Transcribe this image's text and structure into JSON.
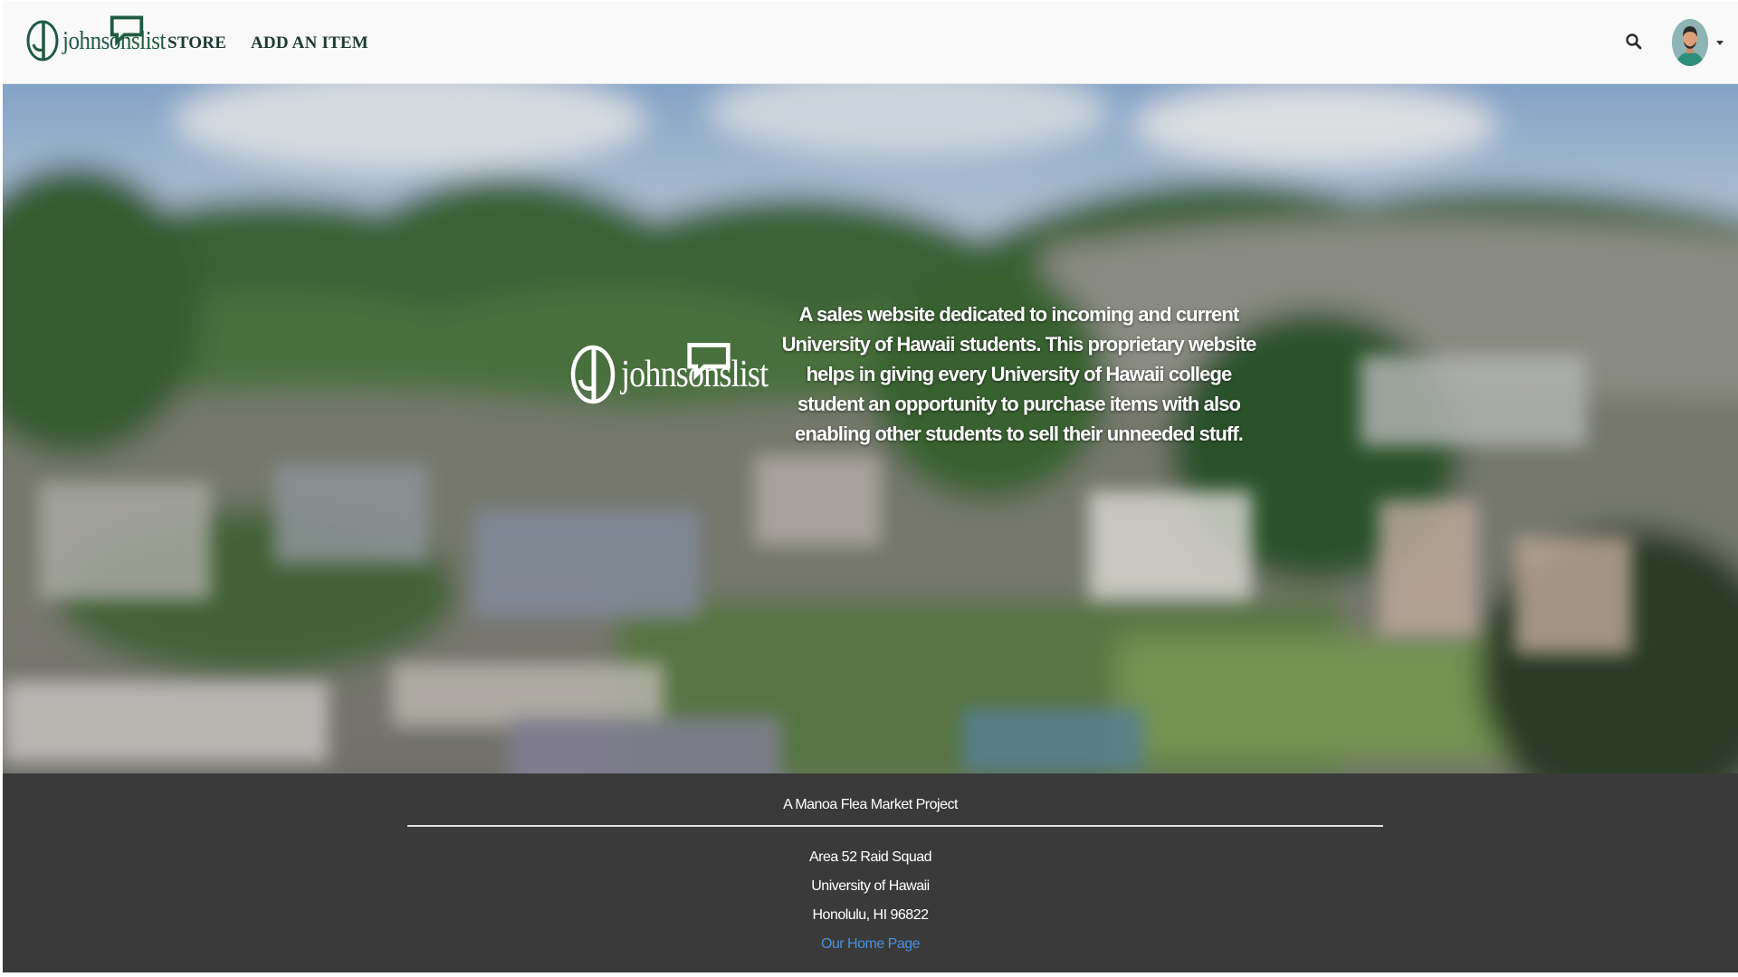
{
  "brand": {
    "name": "johnsonslist",
    "icon": "jl-logo-icon"
  },
  "nav": {
    "links": [
      {
        "label": "STORE"
      },
      {
        "label": "ADD AN ITEM"
      }
    ],
    "search_icon": "search-icon",
    "avatar_icon": "user-avatar"
  },
  "hero": {
    "logo_text": "johnsonslist",
    "description": "A sales website dedicated to incoming and current University of Hawaii students. This proprietary website helps in giving every University of Hawaii college student an opportunity to purchase items with also enabling other students to sell their unneeded stuff."
  },
  "footer": {
    "title": "A Manoa Flea Market Project",
    "lines": [
      "Area 52 Raid Squad",
      "University of Hawaii",
      "Honolulu, HI 96822"
    ],
    "link": "Our Home Page"
  },
  "colors": {
    "brand_green": "#1f5a43",
    "nav_bg": "#f8f9f8",
    "footer_bg": "#3a3a3a",
    "link_blue": "#4a90d9"
  }
}
